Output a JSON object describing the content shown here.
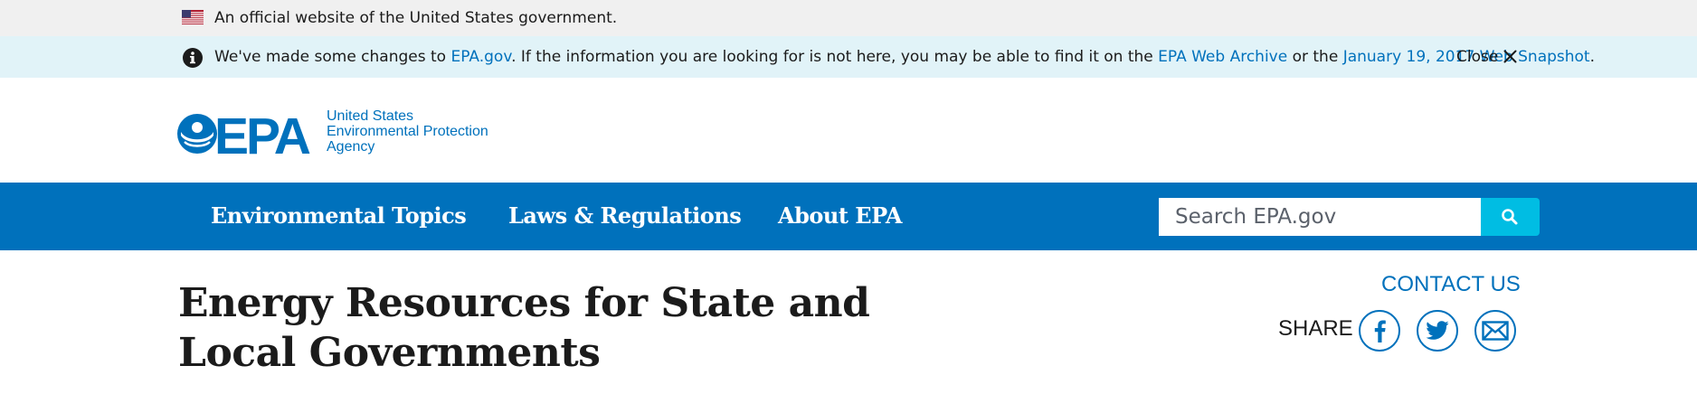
{
  "official_banner": {
    "flag_icon": "us-flag-icon",
    "text": "An official website of the United States government."
  },
  "notice": {
    "icon": "info-icon",
    "text_before": "We've made some changes to ",
    "link1": "EPA.gov",
    "text_middle": ". If the information you are looking for is not here, you may be able to find it on the ",
    "link2": "EPA Web Archive",
    "text_or": " or the ",
    "link3": "January 19, 2017 Web Snapshot",
    "text_end": ".",
    "close_label": "Close",
    "close_icon": "close-icon"
  },
  "header": {
    "logo_wordmark": "EPA",
    "logo_line1": "United States",
    "logo_line2": "Environmental Protection",
    "logo_line3": "Agency"
  },
  "nav": {
    "items": [
      {
        "label": "Environmental Topics"
      },
      {
        "label": "Laws & Regulations"
      },
      {
        "label": "About EPA"
      }
    ],
    "search_placeholder": "Search EPA.gov",
    "search_icon": "search-icon"
  },
  "page": {
    "title": "Energy Resources for State and Local Governments",
    "contact_label": "CONTACT US",
    "share_label": "SHARE",
    "share_icons": [
      "facebook-icon",
      "twitter-icon",
      "email-icon"
    ]
  },
  "colors": {
    "primary_blue": "#0071bc",
    "search_button": "#00bde3",
    "notice_background": "#e1f3f8",
    "official_background": "#f0f0f0"
  }
}
